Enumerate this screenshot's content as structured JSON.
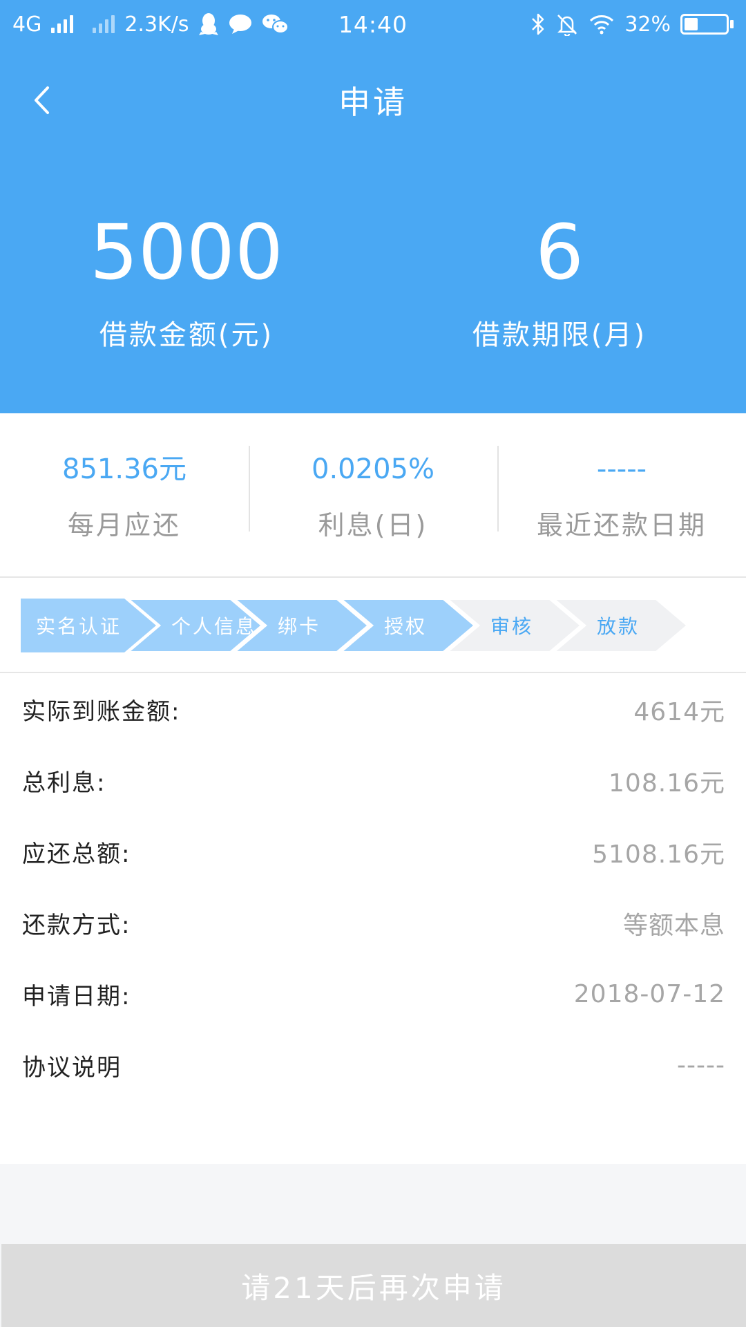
{
  "status_bar": {
    "network": "4G",
    "speed": "2.3K/s",
    "time": "14:40",
    "battery": "32%",
    "battery_level": 0.32,
    "icons": [
      "signal-bars-icon",
      "signal-bars-secondary-icon",
      "qq-penguin-icon",
      "message-bubble-icon",
      "wechat-icon",
      "bluetooth-icon",
      "mute-bell-icon",
      "wifi-icon",
      "battery-icon"
    ]
  },
  "nav": {
    "back_icon": "chevron-left-icon",
    "title": "申请"
  },
  "hero": {
    "amount_value": "5000",
    "amount_label": "借款金额(元)",
    "term_value": "6",
    "term_label": "借款期限(月)"
  },
  "summary": {
    "monthly_value": "851.36元",
    "monthly_label": "每月应还",
    "interest_value": "0.0205%",
    "interest_label": "利息(日)",
    "recent_value": "-----",
    "recent_label": "最近还款日期"
  },
  "steps": [
    {
      "label": "实名认证",
      "status": "done"
    },
    {
      "label": "个人信息",
      "status": "done"
    },
    {
      "label": "绑卡",
      "status": "done"
    },
    {
      "label": "授权",
      "status": "done"
    },
    {
      "label": "审核",
      "status": "todo"
    },
    {
      "label": "放款",
      "status": "todo"
    }
  ],
  "details": {
    "received_label": "实际到账金额:",
    "received_value": "4614元",
    "total_interest_label": "总利息:",
    "total_interest_value": "108.16元",
    "total_repay_label": "应还总额:",
    "total_repay_value": "5108.16元",
    "method_label": "还款方式:",
    "method_value": "等额本息",
    "date_label": "申请日期:",
    "date_value": "2018-07-12",
    "agreement_label": "协议说明",
    "agreement_value": "-----"
  },
  "footer": {
    "reapply_label": "请21天后再次申请"
  },
  "colors": {
    "primary_blue": "#4aa8f3",
    "step_done": "#9dd0fb",
    "step_todo": "#f0f1f3",
    "disabled_button": "#dcdcdc"
  }
}
